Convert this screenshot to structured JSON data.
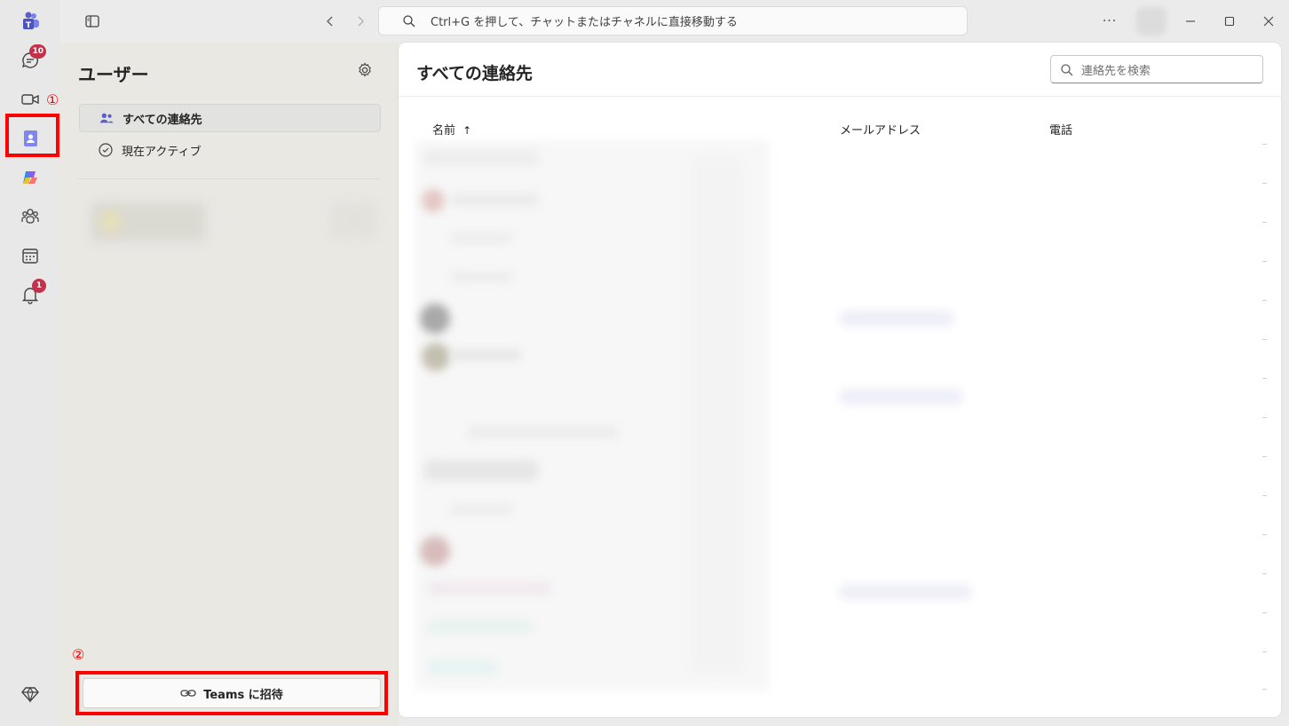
{
  "annotations": {
    "marker_1": "①",
    "marker_2": "②"
  },
  "rail": {
    "chat_badge": "10",
    "activity_badge": "1"
  },
  "titlebar": {
    "search_placeholder": "Ctrl+G を押して、チャットまたはチャネルに直接移動する",
    "more_label": "···"
  },
  "sidepanel": {
    "title": "ユーザー",
    "items": [
      {
        "label": "すべての連絡先",
        "icon": "people-icon",
        "active": true
      },
      {
        "label": "現在アクティブ",
        "icon": "check-circle-icon",
        "active": false
      }
    ],
    "invite_button": "Teams に招待"
  },
  "main": {
    "title": "すべての連絡先",
    "search_placeholder": "連絡先を検索",
    "columns": {
      "name": "名前",
      "sort_indicator": "↑",
      "email": "メールアドレス",
      "phone": "電話"
    }
  },
  "colors": {
    "accent": "#5b5fc7",
    "highlight": "#ff0000",
    "badge": "#c4314b"
  }
}
